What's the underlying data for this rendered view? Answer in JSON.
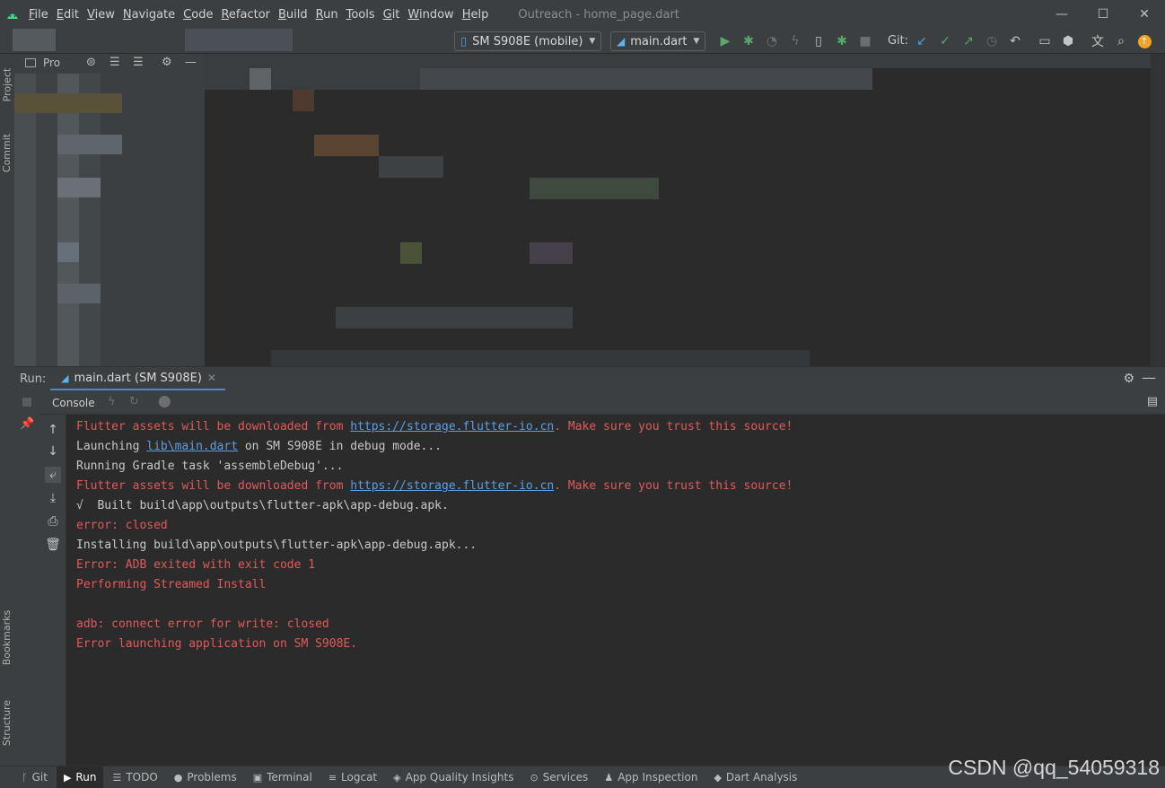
{
  "titlebar": {
    "menu": [
      {
        "letter": "F",
        "rest": "ile"
      },
      {
        "letter": "E",
        "rest": "dit"
      },
      {
        "letter": "V",
        "rest": "iew"
      },
      {
        "letter": "N",
        "rest": "avigate"
      },
      {
        "letter": "C",
        "rest": "ode"
      },
      {
        "letter": "R",
        "rest": "efactor"
      },
      {
        "letter": "B",
        "rest": "uild"
      },
      {
        "letter": "R",
        "rest": "un"
      },
      {
        "letter": "T",
        "rest": "ools"
      },
      {
        "letter": "G",
        "rest": "it"
      },
      {
        "letter": "W",
        "rest": "indow"
      },
      {
        "letter": "H",
        "rest": "elp"
      }
    ],
    "window_title": "Outreach - home_page.dart",
    "controls": {
      "minimize": "—",
      "maximize": "☐",
      "close": "✕"
    }
  },
  "toolbar": {
    "device": "SM S908E (mobile)",
    "config": "main.dart",
    "git_label": "Git:",
    "icons": [
      "run-icon",
      "debug-icon",
      "profile-icon",
      "hot-reload-icon",
      "attach-icon",
      "debug-attach-icon",
      "stop-icon",
      "git-update-icon",
      "git-commit-icon",
      "git-push-icon",
      "git-history-icon",
      "git-rollback-icon",
      "device-manager-icon",
      "sdk-manager-icon",
      "translate-icon",
      "search-icon",
      "updates-icon"
    ]
  },
  "left_strip": {
    "project": "Project",
    "commit": "Commit",
    "bookmarks": "Bookmarks",
    "structure": "Structure"
  },
  "project_panel": {
    "title": "Pro"
  },
  "run_panel": {
    "label": "Run:",
    "tab": "main.dart (SM S908E)",
    "console_label": "Console"
  },
  "console": {
    "lines": [
      {
        "type": "err",
        "parts": [
          "Flutter assets will be downloaded from ",
          "https://storage.flutter-io.cn",
          ". Make sure you trust this source!"
        ]
      },
      {
        "type": "norm",
        "parts": [
          "Launching ",
          "lib\\main.dart",
          " on SM S908E in debug mode..."
        ]
      },
      {
        "type": "norm",
        "parts": [
          "Running Gradle task 'assembleDebug'..."
        ]
      },
      {
        "type": "err",
        "parts": [
          "Flutter assets will be downloaded from ",
          "https://storage.flutter-io.cn",
          ". Make sure you trust this source!"
        ]
      },
      {
        "type": "norm",
        "parts": [
          "√  Built build\\app\\outputs\\flutter-apk\\app-debug.apk."
        ]
      },
      {
        "type": "err",
        "parts": [
          "error: closed"
        ]
      },
      {
        "type": "norm",
        "parts": [
          "Installing build\\app\\outputs\\flutter-apk\\app-debug.apk..."
        ]
      },
      {
        "type": "err",
        "parts": [
          "Error: ADB exited with exit code 1"
        ]
      },
      {
        "type": "err",
        "parts": [
          "Performing Streamed Install"
        ]
      },
      {
        "type": "err",
        "parts": [
          ""
        ]
      },
      {
        "type": "err",
        "parts": [
          "adb: connect error for write: closed"
        ]
      },
      {
        "type": "err",
        "parts": [
          "Error launching application on SM S908E."
        ]
      }
    ]
  },
  "statusbar": {
    "tabs": [
      {
        "icon": "git-branch-icon",
        "label": "Git"
      },
      {
        "icon": "run-icon",
        "label": "Run",
        "active": true
      },
      {
        "icon": "todo-icon",
        "label": "TODO"
      },
      {
        "icon": "problems-icon",
        "label": "Problems"
      },
      {
        "icon": "terminal-icon",
        "label": "Terminal"
      },
      {
        "icon": "logcat-icon",
        "label": "Logcat"
      },
      {
        "icon": "app-quality-icon",
        "label": "App Quality Insights"
      },
      {
        "icon": "services-icon",
        "label": "Services"
      },
      {
        "icon": "app-inspection-icon",
        "label": "App Inspection"
      },
      {
        "icon": "dart-analysis-icon",
        "label": "Dart Analysis"
      }
    ]
  },
  "watermark": {
    "main": "CSDN @qq_54059318",
    "shadow": "CSDN @qq_54059318"
  },
  "colors": {
    "error_text": "#e05a5a",
    "link": "#5a9fe6",
    "accent": "#4a88c7",
    "bg": "#2b2b2b",
    "panel": "#3c3f41"
  }
}
